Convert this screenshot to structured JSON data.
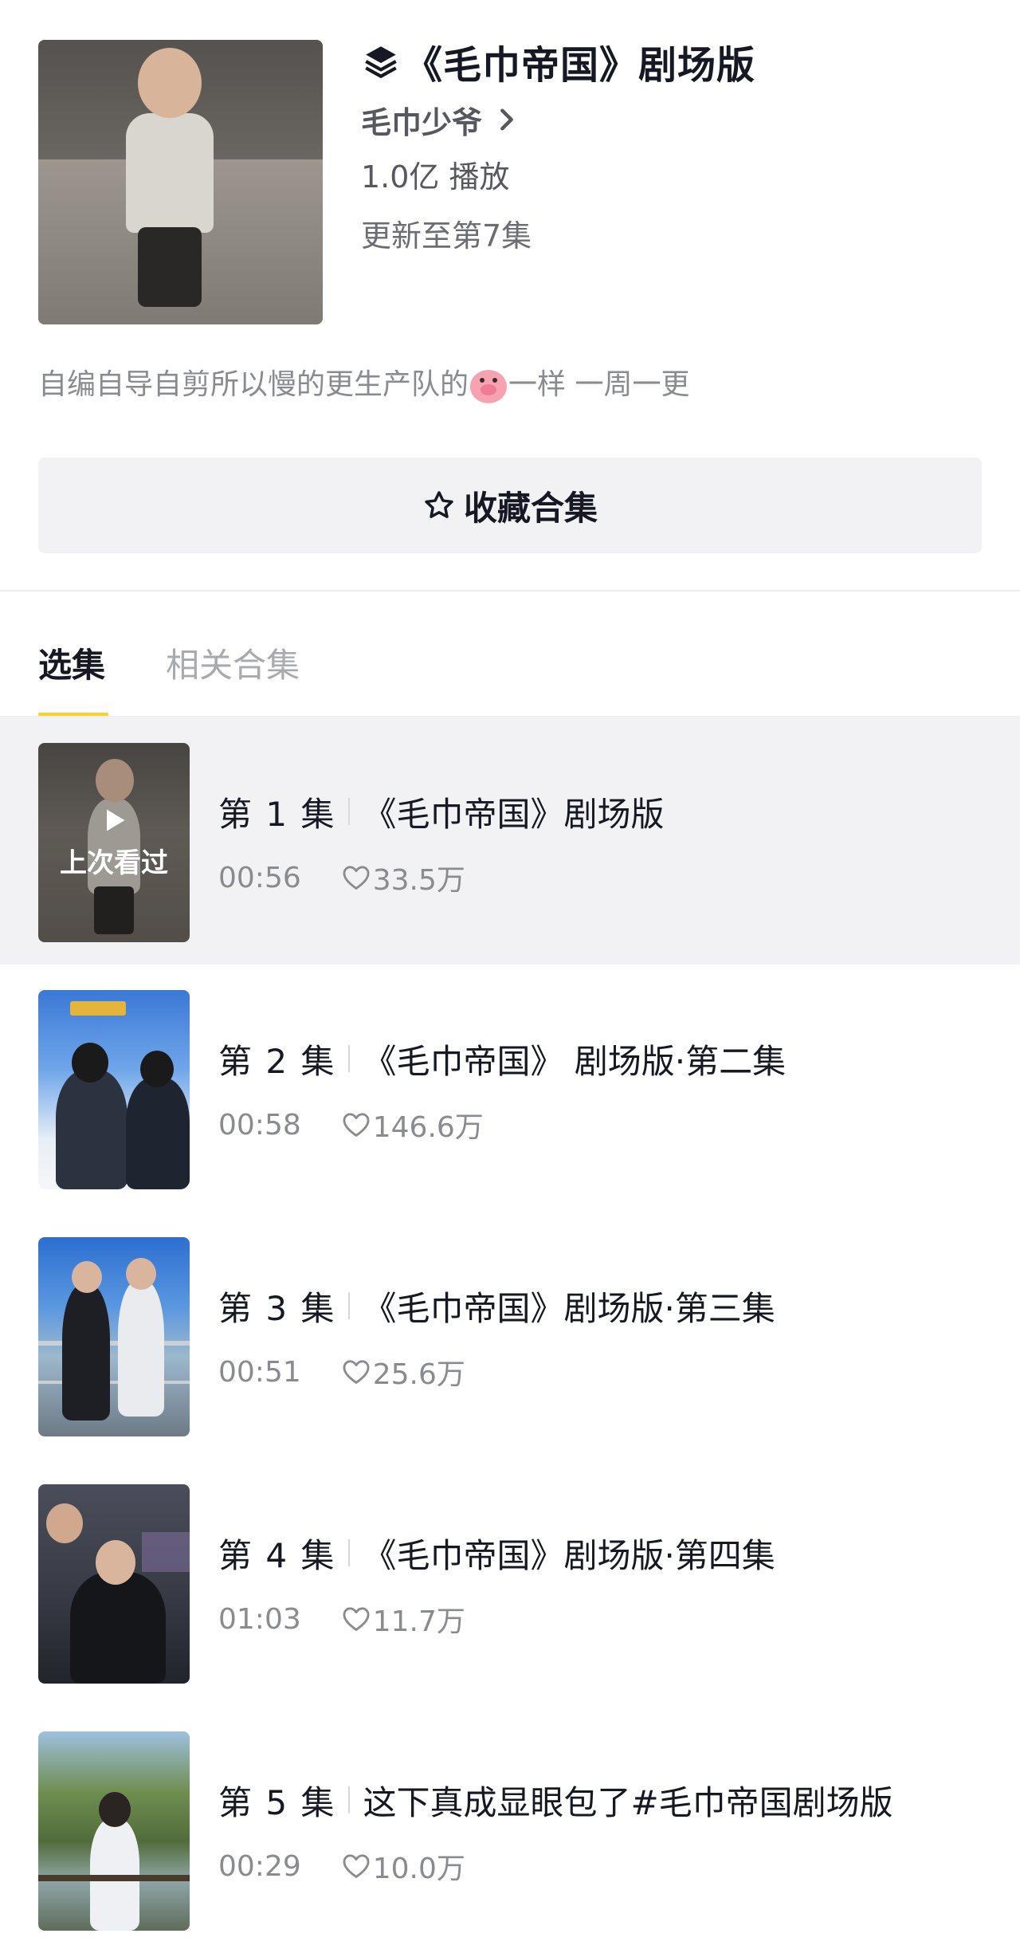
{
  "collection": {
    "title": "《毛巾帝国》剧场版",
    "author": "毛巾少爷",
    "plays": "1.0亿 播放",
    "updated": "更新至第7集",
    "description_before": "自编自导自剪所以慢的更生产队的",
    "description_after": "一样 一周一更",
    "favorite_label": "收藏合集"
  },
  "tabs": {
    "episodes": "选集",
    "related": "相关合集"
  },
  "episodes": [
    {
      "number": "第 1 集",
      "title": "《毛巾帝国》剧场版",
      "duration": "00:56",
      "likes": "33.5万",
      "badge": "上次看过"
    },
    {
      "number": "第 2 集",
      "title": "《毛巾帝国》 剧场版·第二集",
      "duration": "00:58",
      "likes": "146.6万"
    },
    {
      "number": "第 3 集",
      "title": "《毛巾帝国》剧场版·第三集",
      "duration": "00:51",
      "likes": "25.6万"
    },
    {
      "number": "第 4 集",
      "title": "《毛巾帝国》剧场版·第四集",
      "duration": "01:03",
      "likes": "11.7万"
    },
    {
      "number": "第 5 集",
      "title": "这下真成显眼包了#毛巾帝国剧场版",
      "duration": "00:29",
      "likes": "10.0万"
    }
  ],
  "icons": {
    "collection": "stack-layers-icon",
    "author_chevron": "chevron-right-icon",
    "favorite": "star-outline-icon",
    "play": "play-icon",
    "like": "heart-outline-icon",
    "emoji": "pig-face-emoji"
  },
  "colors": {
    "tab_indicator": "#fece2f",
    "active_row_bg": "#f2f2f4",
    "secondary_text": "#8a8b91"
  }
}
